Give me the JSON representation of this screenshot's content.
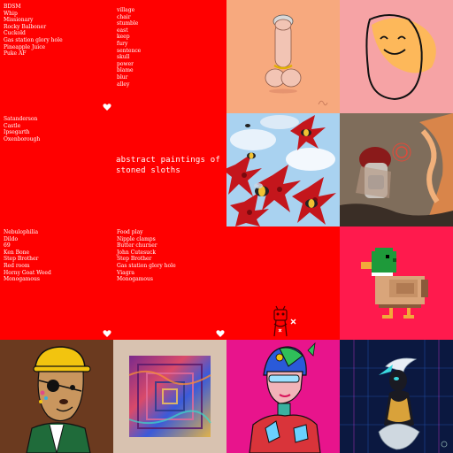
{
  "tiles": {
    "list_left_top": [
      "BDSM",
      "Whip",
      "Missionary",
      "Rocky Balboner",
      "Cuckold",
      "Gas station glory hole",
      "Pineapple Juice",
      "Puke AF"
    ],
    "list_right_top": [
      "village",
      "chair",
      "stumble",
      "east",
      "keep",
      "fury",
      "sentence",
      "skull",
      "power",
      "blame",
      "blur",
      "alley"
    ],
    "list_mid": [
      "Satanderson",
      "Castle",
      "Ipsegarth",
      "Oxenborough"
    ],
    "caption_lines": [
      "abstract paintings of",
      "stoned sloths"
    ],
    "list_left_bottom": [
      "Nebulophilia",
      "Dildo",
      "69",
      "Ken Bone",
      "Step Brother",
      "Red room",
      "Horny Goat Weed",
      "Monogamous"
    ],
    "list_right_bottom": [
      "Food play",
      "Nipple clamps",
      "Butter churner",
      "John Cutesuck",
      "Step Brother",
      "Gas station glory hole",
      "Viagra",
      "Monogamous"
    ]
  },
  "colors": {
    "red": "#ff0000",
    "peach": "#f7a97e",
    "pink": "#f6a3a5",
    "duck_bg": "#ff1a4d",
    "brown": "#6b3a1f",
    "beige": "#d8c2b0",
    "magenta": "#e8148c",
    "navy": "#0b1840"
  },
  "icons": {
    "heart": "heart-icon"
  }
}
